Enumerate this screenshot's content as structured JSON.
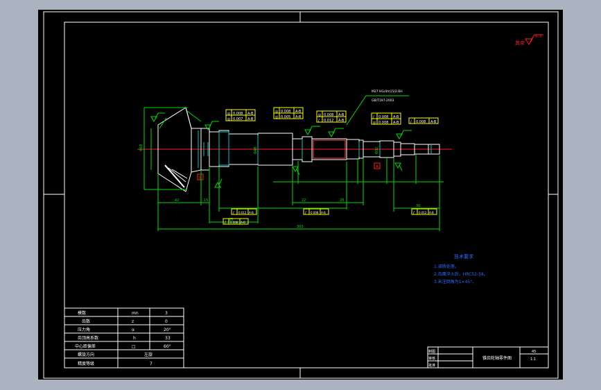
{
  "colors": {
    "background": "#abb3c0",
    "paper": "#000000",
    "frame": "#ffffff",
    "dimension": "#00dd00",
    "centerline": "#ff2020",
    "tolerance_frame": "#ffff00",
    "contour": "#00c8c8",
    "notes": "#2a6cff"
  },
  "roughness_mark": {
    "prefix": "其余",
    "value": "6.3"
  },
  "datum_labels": [
    "B",
    "A"
  ],
  "dimensions": {
    "d1": "42",
    "d2": "15",
    "d3": "25",
    "d4": "22",
    "d5": "28",
    "d6": "30",
    "overall": "300"
  },
  "diameters": {
    "left": "Φ68",
    "mid": "Φ48",
    "tooth": "Φ32"
  },
  "thread_note": {
    "line1": "M27 HG/4m15/2-6H",
    "line2": "GB/T197-2003"
  },
  "tolerance_frames": {
    "f1": [
      "◎",
      "0.008",
      "A-B"
    ],
    "f2": [
      "◎",
      "0.007",
      "A-B"
    ],
    "f3": [
      "◎",
      "0.008",
      "A-B"
    ],
    "f4": [
      "◎",
      "0.005",
      "A-B"
    ],
    "f5": [
      "◎",
      "0.008",
      "A-B"
    ],
    "f6": [
      "/",
      "0.012",
      "A-B"
    ],
    "f7": [
      "/",
      "0.008",
      "A-B"
    ],
    "f8": [
      "◎",
      "0.008",
      "A-B"
    ],
    "f9": [
      "/",
      "0.008",
      "A-B"
    ]
  },
  "tech_requirements": {
    "title": "技术要求",
    "items": [
      "1.调质处理。",
      "2.齿面淬火后，HRC52-58。",
      "3.未注倒角为1×45°。"
    ]
  },
  "gear_params": {
    "rows": [
      {
        "label": "模数",
        "symbol": "mn",
        "value": "3"
      },
      {
        "label": "齿数",
        "symbol": "z",
        "value": "0"
      },
      {
        "label": "压力角",
        "symbol": "α",
        "value": "20°"
      },
      {
        "label": "齿顶高系数",
        "symbol": "h",
        "value": "33"
      },
      {
        "label": "中心距偏差",
        "symbol": "□",
        "value": "60°"
      },
      {
        "label": "螺旋方向",
        "symbol": "左旋",
        "value": ""
      },
      {
        "label": "精度等级",
        "symbol": "7",
        "value": ""
      }
    ]
  },
  "title_block": {
    "drawing_name": "锥齿轮轴零件图",
    "material": "45",
    "scale": "1:1",
    "left_labels": [
      "制图",
      "审核",
      "批准"
    ]
  }
}
